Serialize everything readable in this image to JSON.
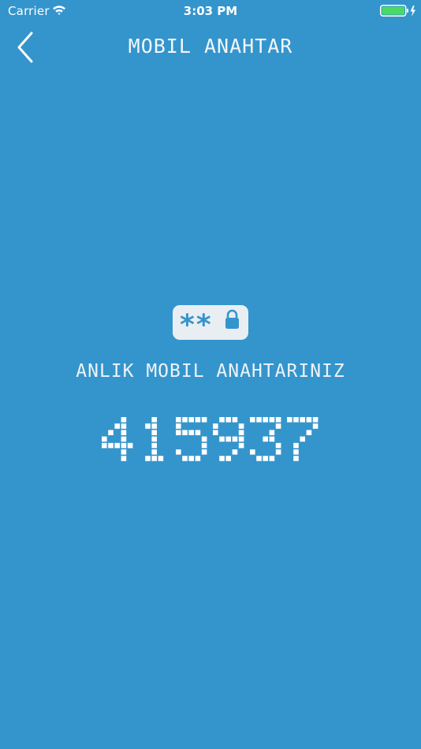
{
  "status_bar": {
    "carrier": "Carrier",
    "time": "3:03 PM",
    "icons": [
      "wifi-icon",
      "battery-icon",
      "charging-bolt-icon"
    ]
  },
  "nav": {
    "title": "MOBIL ANAHTAR",
    "back_icon": "chevron-left-icon"
  },
  "key_badge": {
    "icon": "password-lock-icon",
    "text": "**"
  },
  "main": {
    "label": "ANLIK MOBIL ANAHTARINIZ",
    "code": "415937"
  },
  "colors": {
    "background": "#3495cc",
    "text": "#ffffff",
    "badge_bg": "#e9eef3",
    "badge_fg": "#3495cc",
    "battery_green": "#4cd964"
  }
}
